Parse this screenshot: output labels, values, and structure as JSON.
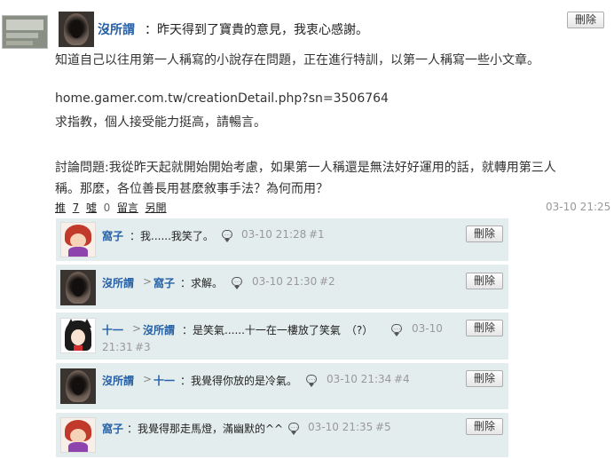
{
  "post": {
    "author": "沒所謂",
    "headline": "：昨天得到了寶貴的意見，我衷心感謝。",
    "line1": "知道自己以往用第一人稱寫的小說存在問題，正在進行特訓，以第一人稱寫一些小文章。",
    "url": "home.gamer.com.tw/creationDetail.php?sn=3506764",
    "line2": "求指教，個人接受能力挺高，請暢言。",
    "line3": "討論問題:我從昨天起就開始開始考慮，如果第一人稱還是無法好好運用的話，就轉用第三人",
    "line4": "稱。那麼，各位善長用甚麼敘事手法？為何而用？",
    "delete_label": "刪除",
    "actions": {
      "push_label": "推",
      "push_count": "7",
      "boo_label": "噓",
      "boo_count": "0",
      "comment_label": "留言",
      "share_label": "另開"
    },
    "timestamp": "03-10 21:25"
  },
  "replies": [
    {
      "author": "窩子",
      "text": "：我......我笑了。",
      "time": "03-10 21:28",
      "num": "#1",
      "delete_label": "刪除"
    },
    {
      "author": "沒所謂",
      "arrow": ">",
      "target": "窩子",
      "text": "：求解。",
      "time": "03-10 21:30",
      "num": "#2",
      "delete_label": "刪除"
    },
    {
      "author": "十一",
      "arrow": ">",
      "target": "沒所謂",
      "text": "：是笑氣......十一在一樓放了笑氣　（?）",
      "time1": "03-10",
      "time2": "21:31",
      "num": "#3",
      "delete_label": "刪除"
    },
    {
      "author": "沒所謂",
      "arrow": ">",
      "target": "十一",
      "text": "：我覺得你放的是冷氣。",
      "time": "03-10 21:34",
      "num": "#4",
      "delete_label": "刪除"
    },
    {
      "author": "窩子",
      "text": "：我覺得那走馬燈，滿幽默的^^",
      "time": "03-10 21:35",
      "num": "#5",
      "delete_label": "刪除"
    }
  ]
}
